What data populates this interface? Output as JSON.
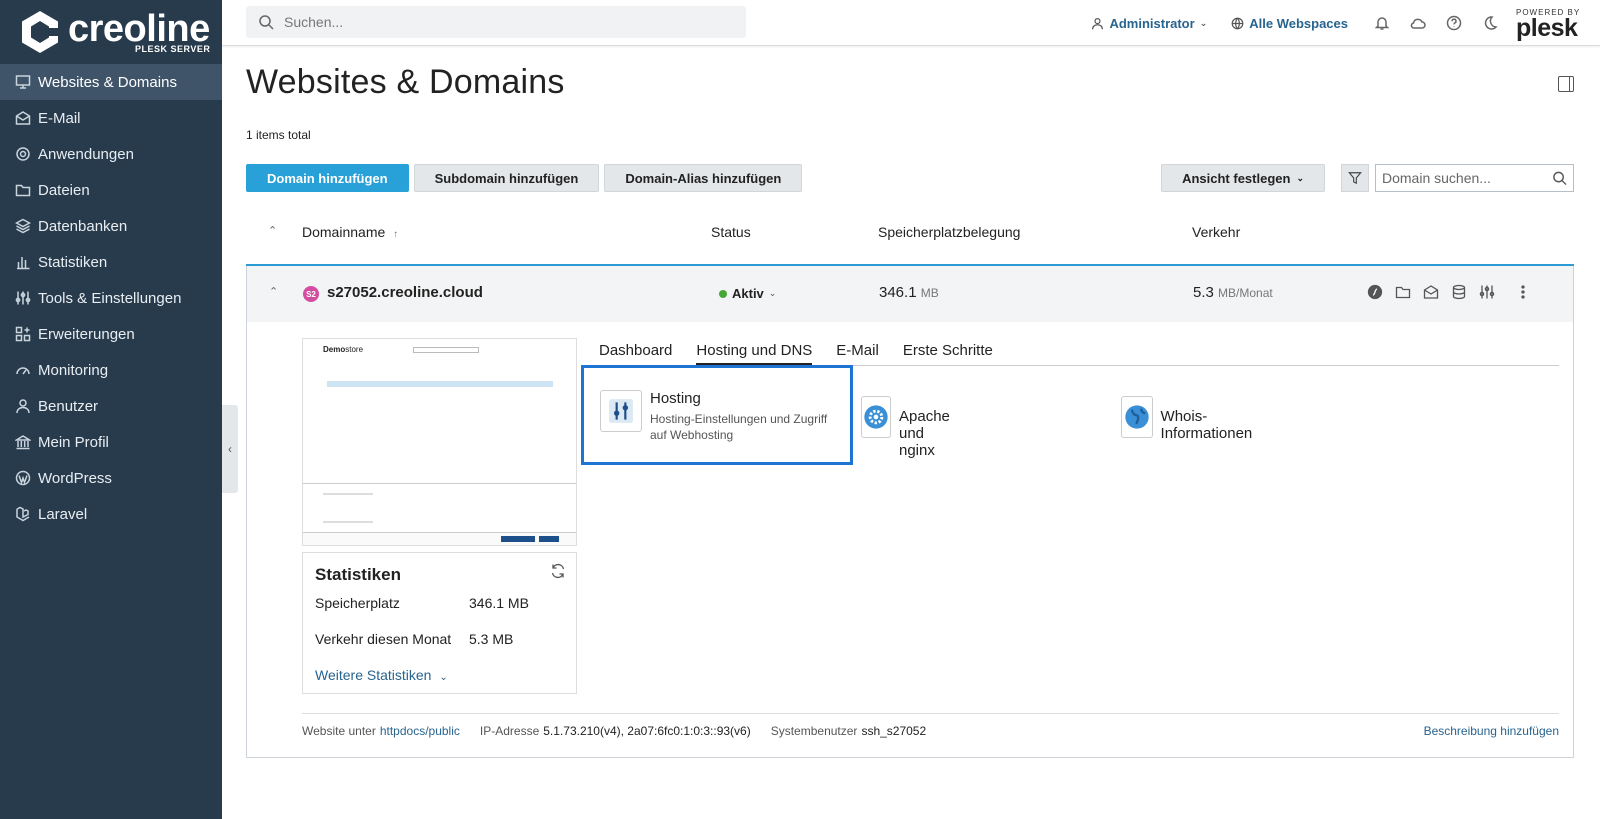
{
  "sidebar": {
    "brand": "creoline",
    "brand_sub": "PLESK SERVER",
    "items": [
      {
        "label": "Websites & Domains"
      },
      {
        "label": "E-Mail"
      },
      {
        "label": "Anwendungen"
      },
      {
        "label": "Dateien"
      },
      {
        "label": "Datenbanken"
      },
      {
        "label": "Statistiken"
      },
      {
        "label": "Tools & Einstellungen"
      },
      {
        "label": "Erweiterungen"
      },
      {
        "label": "Monitoring"
      },
      {
        "label": "Benutzer"
      },
      {
        "label": "Mein Profil"
      },
      {
        "label": "WordPress"
      },
      {
        "label": "Laravel"
      }
    ]
  },
  "topbar": {
    "search_placeholder": "Suchen...",
    "user": "Administrator",
    "webspaces": "Alle Webspaces",
    "powered_by": "POWERED BY",
    "plesk": "plesk"
  },
  "page": {
    "title": "Websites & Domains",
    "total": "1 items total"
  },
  "toolbar": {
    "add_domain": "Domain hinzufügen",
    "add_subdomain": "Subdomain hinzufügen",
    "add_alias": "Domain-Alias hinzufügen",
    "view": "Ansicht festlegen",
    "domain_search_placeholder": "Domain suchen..."
  },
  "table": {
    "headers": {
      "name": "Domainname",
      "status": "Status",
      "storage": "Speicherplatzbelegung",
      "traffic": "Verkehr"
    }
  },
  "domain": {
    "avatar": "S2",
    "name": "s27052.creoline.cloud",
    "status": "Aktiv",
    "storage_value": "346.1",
    "storage_unit": "MB",
    "traffic_value": "5.3",
    "traffic_unit": "MB/Monat"
  },
  "preview": {
    "logo_a": "Demo",
    "logo_b": "store"
  },
  "stats": {
    "title": "Statistiken",
    "storage_label": "Speicherplatz",
    "storage_value": "346.1 MB",
    "traffic_label": "Verkehr diesen Monat",
    "traffic_value": "5.3 MB",
    "more": "Weitere Statistiken"
  },
  "tabs": [
    {
      "label": "Dashboard"
    },
    {
      "label": "Hosting und DNS"
    },
    {
      "label": "E-Mail"
    },
    {
      "label": "Erste Schritte"
    }
  ],
  "tiles": {
    "hosting_title": "Hosting",
    "hosting_desc": "Hosting-Einstellungen und Zugriff auf Webhosting",
    "apache": "Apache und nginx",
    "whois": "Whois-Informationen"
  },
  "footer": {
    "website_label": "Website unter",
    "website_path": "httpdocs/public",
    "ip_label": "IP-Adresse",
    "ip_value": "5.1.73.210(v4), 2a07:6fc0:1:0:3::93(v6)",
    "sysuser_label": "Systembenutzer",
    "sysuser_value": "ssh_s27052",
    "add_description": "Beschreibung hinzufügen"
  },
  "colors": {
    "sidebar": "#283b4c",
    "primary": "#28a0d8",
    "link": "#28648f",
    "active_dot": "#45a836",
    "selection": "#1d74d3"
  }
}
